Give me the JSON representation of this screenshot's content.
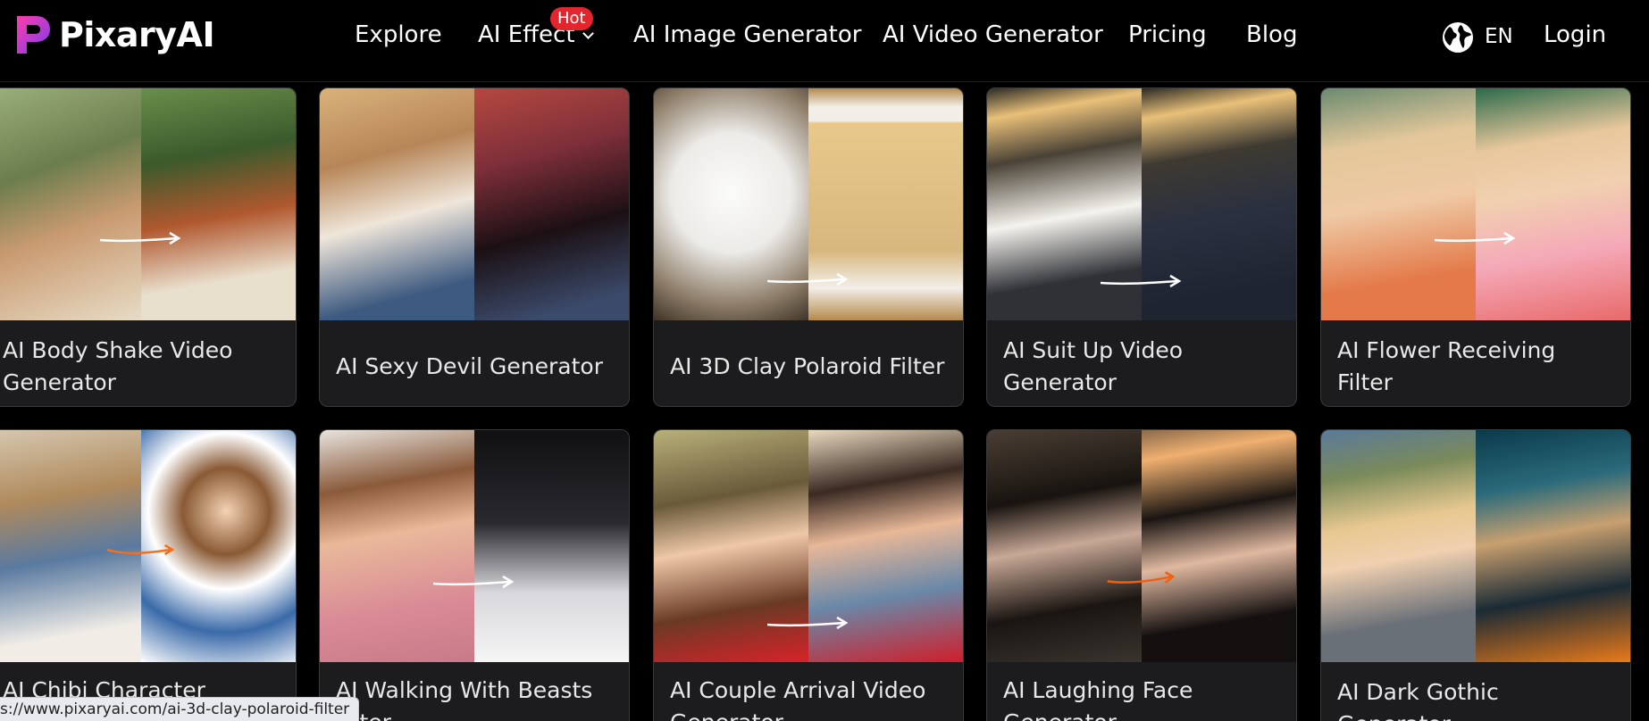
{
  "header": {
    "logo_text": "PixaryAI",
    "nav": [
      {
        "label": "Explore"
      },
      {
        "label": "AI Effect"
      },
      {
        "label": "AI Image Generator"
      },
      {
        "label": "AI Video Generator"
      },
      {
        "label": "Pricing"
      },
      {
        "label": "Blog"
      }
    ],
    "hot_badge": "Hot",
    "language": "EN",
    "login": "Login",
    "colors": {
      "brand_gradient_start": "#ff3cac",
      "brand_gradient_end": "#784ba0",
      "hot": "#e3252d"
    }
  },
  "cards": [
    {
      "title": "AI Body Shake Video Generator"
    },
    {
      "title": "AI Sexy Devil Generator"
    },
    {
      "title": "AI 3D Clay Polaroid Filter"
    },
    {
      "title": "AI Suit Up Video Generator"
    },
    {
      "title": "AI Flower Receiving Filter"
    },
    {
      "title": "AI Chibi Character"
    },
    {
      "title": "AI Walking With Beasts Filter"
    },
    {
      "title": "AI Couple Arrival Video Generator"
    },
    {
      "title": "AI Laughing Face Generator"
    },
    {
      "title": "AI Dark Gothic Generator"
    }
  ],
  "status_bar": {
    "url": "s://www.pixaryai.com/ai-3d-clay-polaroid-filter"
  }
}
